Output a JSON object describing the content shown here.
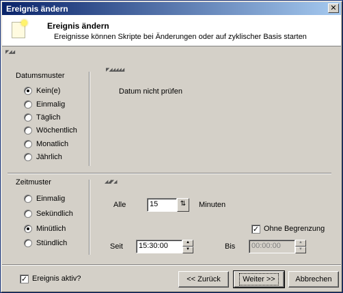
{
  "window": {
    "title": "Ereignis ändern",
    "close_glyph": "✕"
  },
  "header": {
    "title": "Ereignis ändern",
    "subtitle": "Ereignisse können Skripte bei Änderungen oder auf zyklischer Basis starten",
    "icon": "event-document-icon"
  },
  "date_pattern": {
    "label": "Datumsmuster",
    "options": [
      "Kein(e)",
      "Einmalig",
      "Täglich",
      "Wöchentlich",
      "Monatlich",
      "Jährlich"
    ],
    "selected": "Kein(e)",
    "detail_text": "Datum nicht prüfen"
  },
  "time_pattern": {
    "label": "Zeitmuster",
    "options": [
      "Einmalig",
      "Sekündlich",
      "Minütlich",
      "Stündlich"
    ],
    "selected": "Minütlich",
    "every_label": "Alle",
    "every_value": "15",
    "unit_label": "Minuten",
    "unlimited_label": "Ohne Begrenzung",
    "unlimited_checked": true,
    "since_label": "Seit",
    "since_value": "15:30:00",
    "until_label": "Bis",
    "until_value": "00:00:00"
  },
  "footer": {
    "active_label": "Ereignis aktiv?",
    "active_checked": true,
    "back_label": "<< Zurück",
    "next_label": "Weiter >>",
    "cancel_label": "Abbrechen"
  },
  "colors": {
    "titlebar_start": "#0a246a",
    "titlebar_end": "#a6caf0",
    "dialog_bg": "#d4d0c8"
  }
}
